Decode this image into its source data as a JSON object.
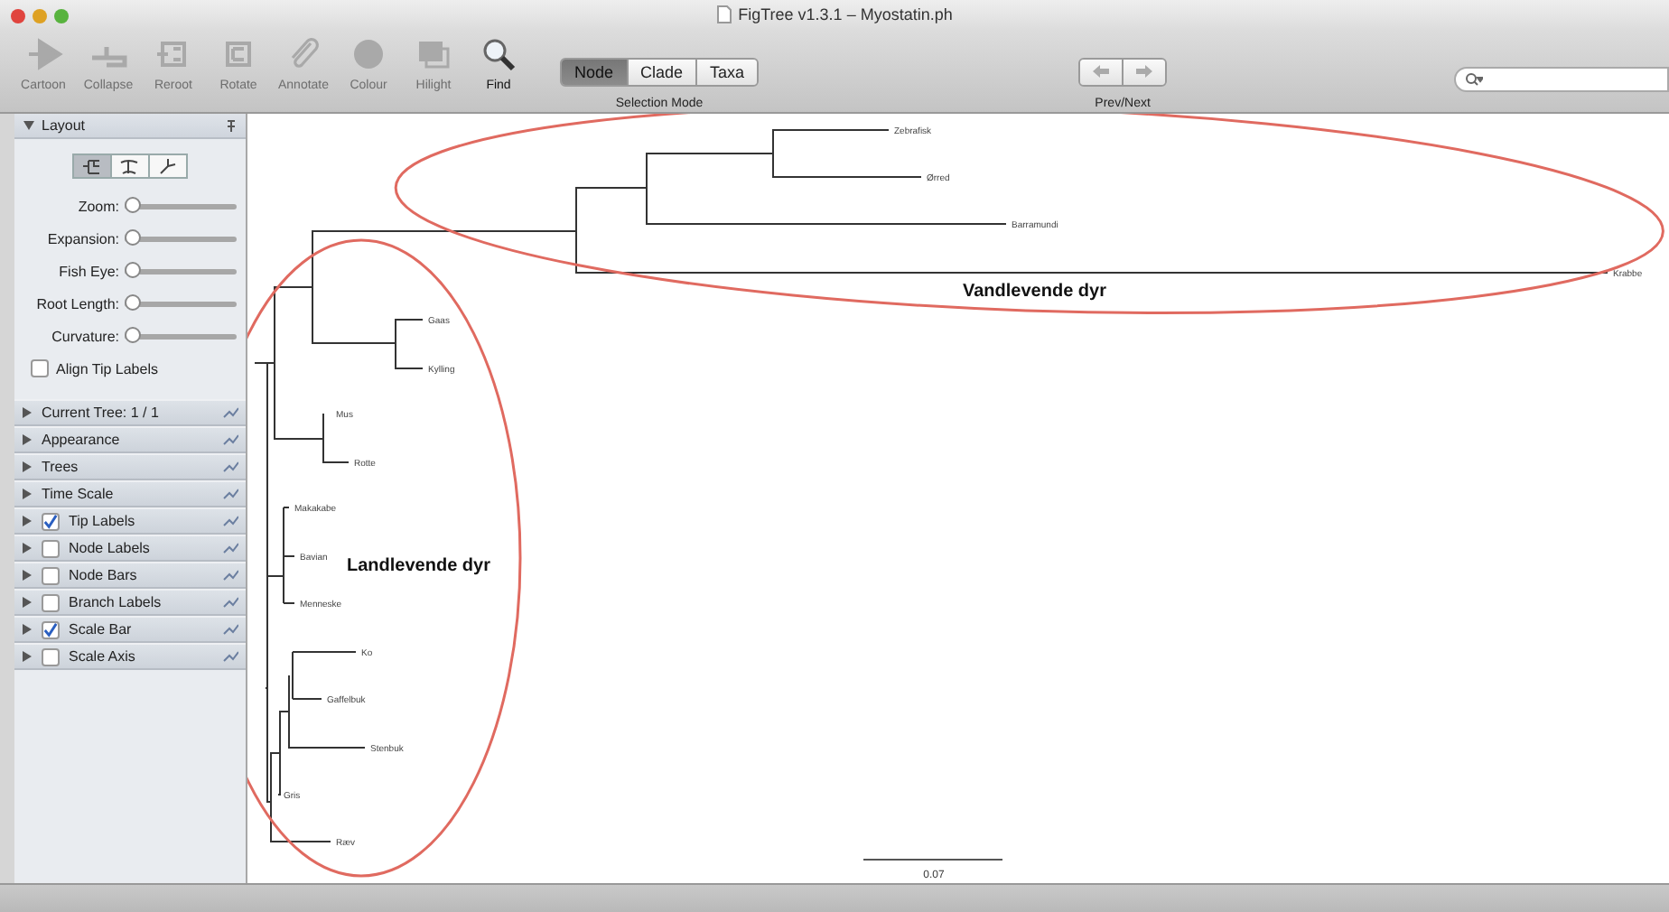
{
  "window": {
    "title": "FigTree v1.3.1 – Myostatin.ph"
  },
  "toolbar": {
    "tools": [
      {
        "label": "Cartoon",
        "kind": "cartoon",
        "disabled": true
      },
      {
        "label": "Collapse",
        "kind": "collapse",
        "disabled": true
      },
      {
        "label": "Reroot",
        "kind": "reroot",
        "disabled": true
      },
      {
        "label": "Rotate",
        "kind": "rotate",
        "disabled": true
      },
      {
        "label": "Annotate",
        "kind": "annotate",
        "disabled": true
      },
      {
        "label": "Colour",
        "kind": "colour",
        "disabled": true
      },
      {
        "label": "Hilight",
        "kind": "hilight",
        "disabled": true
      },
      {
        "label": "Find",
        "kind": "find",
        "disabled": false
      }
    ],
    "selection_mode": {
      "label": "Selection Mode",
      "options": [
        {
          "label": "Node",
          "selected": true
        },
        {
          "label": "Clade",
          "selected": false
        },
        {
          "label": "Taxa",
          "selected": false
        }
      ]
    },
    "prev_next": {
      "label": "Prev/Next"
    }
  },
  "layout_panel": {
    "title": "Layout",
    "expanded": true,
    "styles": [
      {
        "kind": "rectangular",
        "selected": true
      },
      {
        "kind": "polar",
        "selected": false
      },
      {
        "kind": "radial",
        "selected": false
      }
    ],
    "sliders": [
      {
        "label": "Zoom:",
        "level": 0
      },
      {
        "label": "Expansion:",
        "level": 0
      },
      {
        "label": "Fish Eye:",
        "level": 0
      },
      {
        "label": "Root Length:",
        "level": 0
      },
      {
        "label": "Curvature:",
        "level": 0
      }
    ],
    "align_tip_labels": {
      "label": "Align Tip Labels",
      "checked": false
    }
  },
  "panels": [
    {
      "label": "Current Tree: 1 / 1",
      "kind": "plain"
    },
    {
      "label": "Appearance",
      "kind": "plain"
    },
    {
      "label": "Trees",
      "kind": "plain"
    },
    {
      "label": "Time Scale",
      "kind": "plain"
    },
    {
      "label": "Tip Labels",
      "kind": "checkbox",
      "checked": true
    },
    {
      "label": "Node Labels",
      "kind": "checkbox",
      "checked": false
    },
    {
      "label": "Node Bars",
      "kind": "checkbox",
      "checked": false
    },
    {
      "label": "Branch Labels",
      "kind": "checkbox",
      "checked": false
    },
    {
      "label": "Scale Bar",
      "kind": "checkbox",
      "checked": true
    },
    {
      "label": "Scale Axis",
      "kind": "checkbox",
      "checked": false
    }
  ],
  "tree": {
    "tips": [
      "Zebrafisk",
      "Ørred",
      "Barramundi",
      "Krabbe",
      "Gaas",
      "Kylling",
      "Mus",
      "Rotte",
      "Makakabe",
      "Bavian",
      "Menneske",
      "Ko",
      "Gaffelbuk",
      "Stenbuk",
      "Gris",
      "Ræv"
    ],
    "annotations": [
      "Vandlevende dyr",
      "Landlevende dyr"
    ],
    "scale_bar": {
      "label": "0.07"
    }
  }
}
